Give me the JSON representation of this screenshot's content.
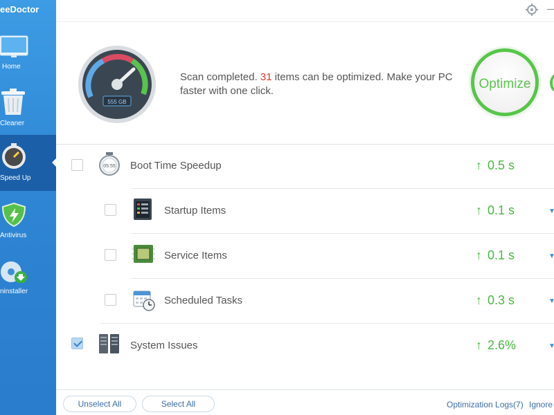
{
  "app": {
    "title": "eeDoctor"
  },
  "sidebar": {
    "items": [
      {
        "label": "Home",
        "icon": "monitor-icon"
      },
      {
        "label": "Cleaner",
        "icon": "trash-icon"
      },
      {
        "label": "Speed Up",
        "icon": "stopwatch-icon",
        "active": true
      },
      {
        "label": "Antivirus",
        "icon": "shield-icon"
      },
      {
        "label": "ninstaller",
        "icon": "disc-download-icon"
      }
    ]
  },
  "header": {
    "gauge_label": "555 GB",
    "scan_prefix": "Scan completed. ",
    "scan_count": "31",
    "scan_suffix": " items can be optimized. Make your PC faster with one click.",
    "optimize_label": "Optimize"
  },
  "rows": [
    {
      "label": "Boot Time Speedup",
      "value": "0.5 s",
      "checked": false,
      "icon": "boot-clock-icon",
      "clock_text": "05:55"
    },
    {
      "label": "Startup Items",
      "value": "0.1 s",
      "checked": false,
      "icon": "startup-list-icon"
    },
    {
      "label": "Service Items",
      "value": "0.1 s",
      "checked": false,
      "icon": "chip-icon"
    },
    {
      "label": "Scheduled Tasks",
      "value": "0.3 s",
      "checked": false,
      "icon": "calendar-clock-icon"
    },
    {
      "label": "System Issues",
      "value": "2.6%",
      "checked": true,
      "icon": "server-icon"
    }
  ],
  "footer": {
    "unselect_all": "Unselect All",
    "select_all": "Select All",
    "logs": "Optimization Logs(7)",
    "ignore": "Ignore"
  },
  "colors": {
    "accent_green": "#48b940",
    "sidebar_blue": "#2e86d4",
    "active_blue": "#1b5fa8",
    "count_red": "#e0352b"
  }
}
